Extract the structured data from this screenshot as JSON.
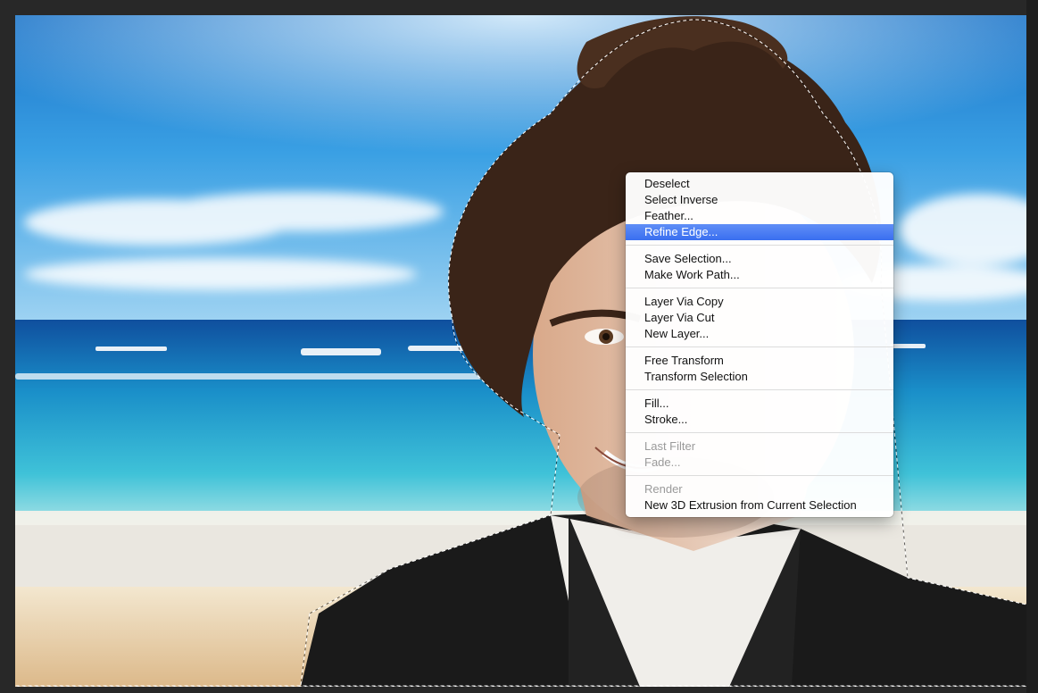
{
  "context_menu": {
    "groups": [
      [
        {
          "label": "Deselect",
          "state": "normal"
        },
        {
          "label": "Select Inverse",
          "state": "normal"
        },
        {
          "label": "Feather...",
          "state": "normal"
        },
        {
          "label": "Refine Edge...",
          "state": "highlighted"
        }
      ],
      [
        {
          "label": "Save Selection...",
          "state": "normal"
        },
        {
          "label": "Make Work Path...",
          "state": "normal"
        }
      ],
      [
        {
          "label": "Layer Via Copy",
          "state": "normal"
        },
        {
          "label": "Layer Via Cut",
          "state": "normal"
        },
        {
          "label": "New Layer...",
          "state": "normal"
        }
      ],
      [
        {
          "label": "Free Transform",
          "state": "normal"
        },
        {
          "label": "Transform Selection",
          "state": "normal"
        }
      ],
      [
        {
          "label": "Fill...",
          "state": "normal"
        },
        {
          "label": "Stroke...",
          "state": "normal"
        }
      ],
      [
        {
          "label": "Last Filter",
          "state": "disabled"
        },
        {
          "label": "Fade...",
          "state": "disabled"
        }
      ],
      [
        {
          "label": "Render",
          "state": "disabled"
        },
        {
          "label": "New 3D Extrusion from Current Selection",
          "state": "normal"
        }
      ]
    ]
  },
  "colors": {
    "highlight": "#3a6ff0",
    "sky_top": "#1b73c8",
    "sea": "#1a8fc9",
    "sand": "#e2c79b",
    "hair": "#3a2418",
    "shirt": "#1a1a1a"
  },
  "icons": {
    "selection": "marching-ants-selection"
  }
}
